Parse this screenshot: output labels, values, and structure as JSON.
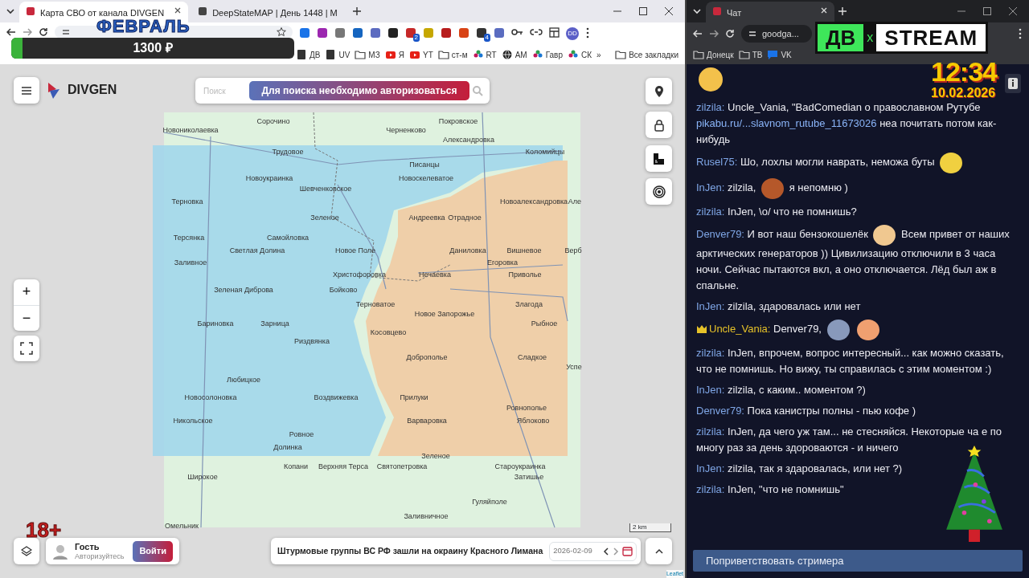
{
  "left_browser": {
    "tabs": [
      {
        "title": "Карта СВО от канала DIVGEN",
        "selected": true
      },
      {
        "title": "DeepStateMAP | День 1448 | M",
        "selected": false
      }
    ],
    "extension_badges": [
      "2",
      "4"
    ],
    "profile": "DD",
    "bookmarks": [
      {
        "label": "ДВ",
        "kind": "page"
      },
      {
        "label": "UV",
        "kind": "page"
      },
      {
        "label": "МЗ",
        "kind": "folder"
      },
      {
        "label": "Я",
        "kind": "video"
      },
      {
        "label": "YT",
        "kind": "video"
      },
      {
        "label": "ст-м",
        "kind": "folder"
      },
      {
        "label": "RT",
        "kind": "flower"
      },
      {
        "label": "AM",
        "kind": "globe"
      },
      {
        "label": "Гавр",
        "kind": "flower"
      },
      {
        "label": "СК",
        "kind": "flower"
      }
    ],
    "more": "»",
    "all_bookmarks": "Все закладки"
  },
  "map_page": {
    "brand": "DIVGEN",
    "search": {
      "placeholder": "Поиск",
      "notice": "Для поиска необходимо авторизоваться"
    },
    "places": [
      "Сорочино",
      "Покровское",
      "Новониколаевка",
      "Черненково",
      "Александровка",
      "Трудовое",
      "Коломийцы",
      "Писанцы",
      "Новоукраинка",
      "Новоскелеватое",
      "Шевченковское",
      "Терновка",
      "Новоалександровка",
      "Але",
      "Зеленое",
      "Андреевка",
      "Отрадное",
      "Терсянка",
      "Самойловка",
      "Светлая Долина",
      "Новое Поле",
      "Даниловка",
      "Вишневое",
      "Верб",
      "Заливное",
      "Егоровка",
      "Христофоровка",
      "Нечаевка",
      "Приволье",
      "Зеленая Диброва",
      "Бойково",
      "Терноватое",
      "Злагода",
      "Новое Запорожье",
      "Бариновка",
      "Зарница",
      "Рыбное",
      "Косовцево",
      "Риздвянка",
      "Доброполье",
      "Сладкое",
      "Успе",
      "Любицкое",
      "Новосолоновка",
      "Воздвижевка",
      "Прилуки",
      "Ровнополье",
      "Никольское",
      "Варваровка",
      "Яблоково",
      "Ровное",
      "Долинка",
      "Зеленое",
      "Копани",
      "Верхняя Терса",
      "Святопетровка",
      "Староукраинка",
      "Широкое",
      "Затишье",
      "Гуляйполе",
      "Заливничное",
      "Омельник"
    ],
    "zoom_in": "+",
    "zoom_out": "−",
    "user": {
      "name": "Гость",
      "hint": "Авторизуйтесь",
      "login": "Войти"
    },
    "news": "Штурмовые группы ВС РФ зашли на окраину Красного Лимана",
    "date": "2026-02-09",
    "scale": "2 km",
    "attribution": "Leaflet"
  },
  "right_browser": {
    "tabs": [
      {
        "title": "Чат",
        "selected": true
      }
    ],
    "address": "goodga...",
    "bookmarks": [
      {
        "label": "Донецк",
        "kind": "folder"
      },
      {
        "label": "ТВ",
        "kind": "folder"
      },
      {
        "label": "VK",
        "kind": "chat"
      }
    ]
  },
  "chat": {
    "messages": [
      {
        "segments": [
          {
            "kind": "emote"
          }
        ]
      },
      {
        "user": "zilzila:",
        "color": "#7fa6e6",
        "badge": false,
        "segments": [
          {
            "kind": "text",
            "text": "Uncle_Vania, \"BadComedian о православном Рутубе"
          },
          {
            "kind": "link",
            "text": "pikabu.ru/...slavnom_rutube_11673026"
          },
          {
            "kind": "text",
            "text": "неа почитать потом как-нибудь"
          }
        ]
      },
      {
        "user": "Rusel75:",
        "color": "#7fa6e6",
        "badge": false,
        "segments": [
          {
            "kind": "text",
            "text": "Шо, лохлы могли наврать, неможа буты"
          },
          {
            "kind": "emote"
          }
        ]
      },
      {
        "user": "InJen:",
        "color": "#7fa6e6",
        "badge": false,
        "segments": [
          {
            "kind": "text",
            "text": "zilzila,"
          },
          {
            "kind": "emote"
          },
          {
            "kind": "text",
            "text": "я непомню )"
          }
        ]
      },
      {
        "user": "zilzila:",
        "color": "#7fa6e6",
        "badge": false,
        "segments": [
          {
            "kind": "text",
            "text": "InJen, \\o/ что не помнишь?"
          }
        ]
      },
      {
        "user": "Denver79:",
        "color": "#7fa6e6",
        "badge": false,
        "segments": [
          {
            "kind": "text",
            "text": "И вот наш бензокошелёк"
          },
          {
            "kind": "emote"
          },
          {
            "kind": "text",
            "text": "Всем привет от наших арктических генераторов )) Цивилизацию отключили в 3 часа ночи. Сейчас пытаются вкл, а оно отключается. Лёд был аж в спальне."
          }
        ]
      },
      {
        "user": "InJen:",
        "color": "#7fa6e6",
        "badge": false,
        "segments": [
          {
            "kind": "text",
            "text": "zilzila, здаровалась или нет"
          }
        ]
      },
      {
        "user": "Uncle_Vania:",
        "color": "#e6c229",
        "badge": true,
        "segments": [
          {
            "kind": "text",
            "text": "Denver79,"
          },
          {
            "kind": "emote"
          },
          {
            "kind": "emote"
          }
        ]
      },
      {
        "user": "zilzila:",
        "color": "#7fa6e6",
        "badge": false,
        "segments": [
          {
            "kind": "text",
            "text": "InJen, впрочем, вопрос интересный... как можно сказать, что не помнишь. Но вижу, ты справилась с этим моментом :)"
          }
        ]
      },
      {
        "user": "InJen:",
        "color": "#7fa6e6",
        "badge": false,
        "segments": [
          {
            "kind": "text",
            "text": "zilzila, с каким.. моментом ?)"
          }
        ]
      },
      {
        "user": "Denver79:",
        "color": "#7fa6e6",
        "badge": false,
        "segments": [
          {
            "kind": "text",
            "text": "Пока канистры полны - пью кофе )"
          }
        ]
      },
      {
        "user": "zilzila:",
        "color": "#7fa6e6",
        "badge": false,
        "segments": [
          {
            "kind": "text",
            "text": "InJen, да чего уж там... не стесняйся. Некоторые ча"
          },
          {
            "kind": "text",
            "text": "е по многу раз за день здороваются - и ничего"
          }
        ]
      },
      {
        "user": "InJen:",
        "color": "#7fa6e6",
        "badge": false,
        "segments": [
          {
            "kind": "text",
            "text": "zilzila, так я здаровалась, или нет ?)"
          }
        ]
      },
      {
        "user": "zilzila:",
        "color": "#7fa6e6",
        "badge": false,
        "segments": [
          {
            "kind": "text",
            "text": "InJen, \"что не помнишь\""
          }
        ]
      }
    ],
    "greet_button": "Поприветствовать стримера"
  },
  "stream_overlay": {
    "month": "ФЕВРАЛЬ",
    "goal": {
      "amount": "1300 ₽",
      "level": 0.04
    },
    "logo_left": "ДВ",
    "logo_mid": "x",
    "logo_right": "STREAM",
    "time": "12:34",
    "date": "10.02.2026",
    "age": "18+"
  }
}
